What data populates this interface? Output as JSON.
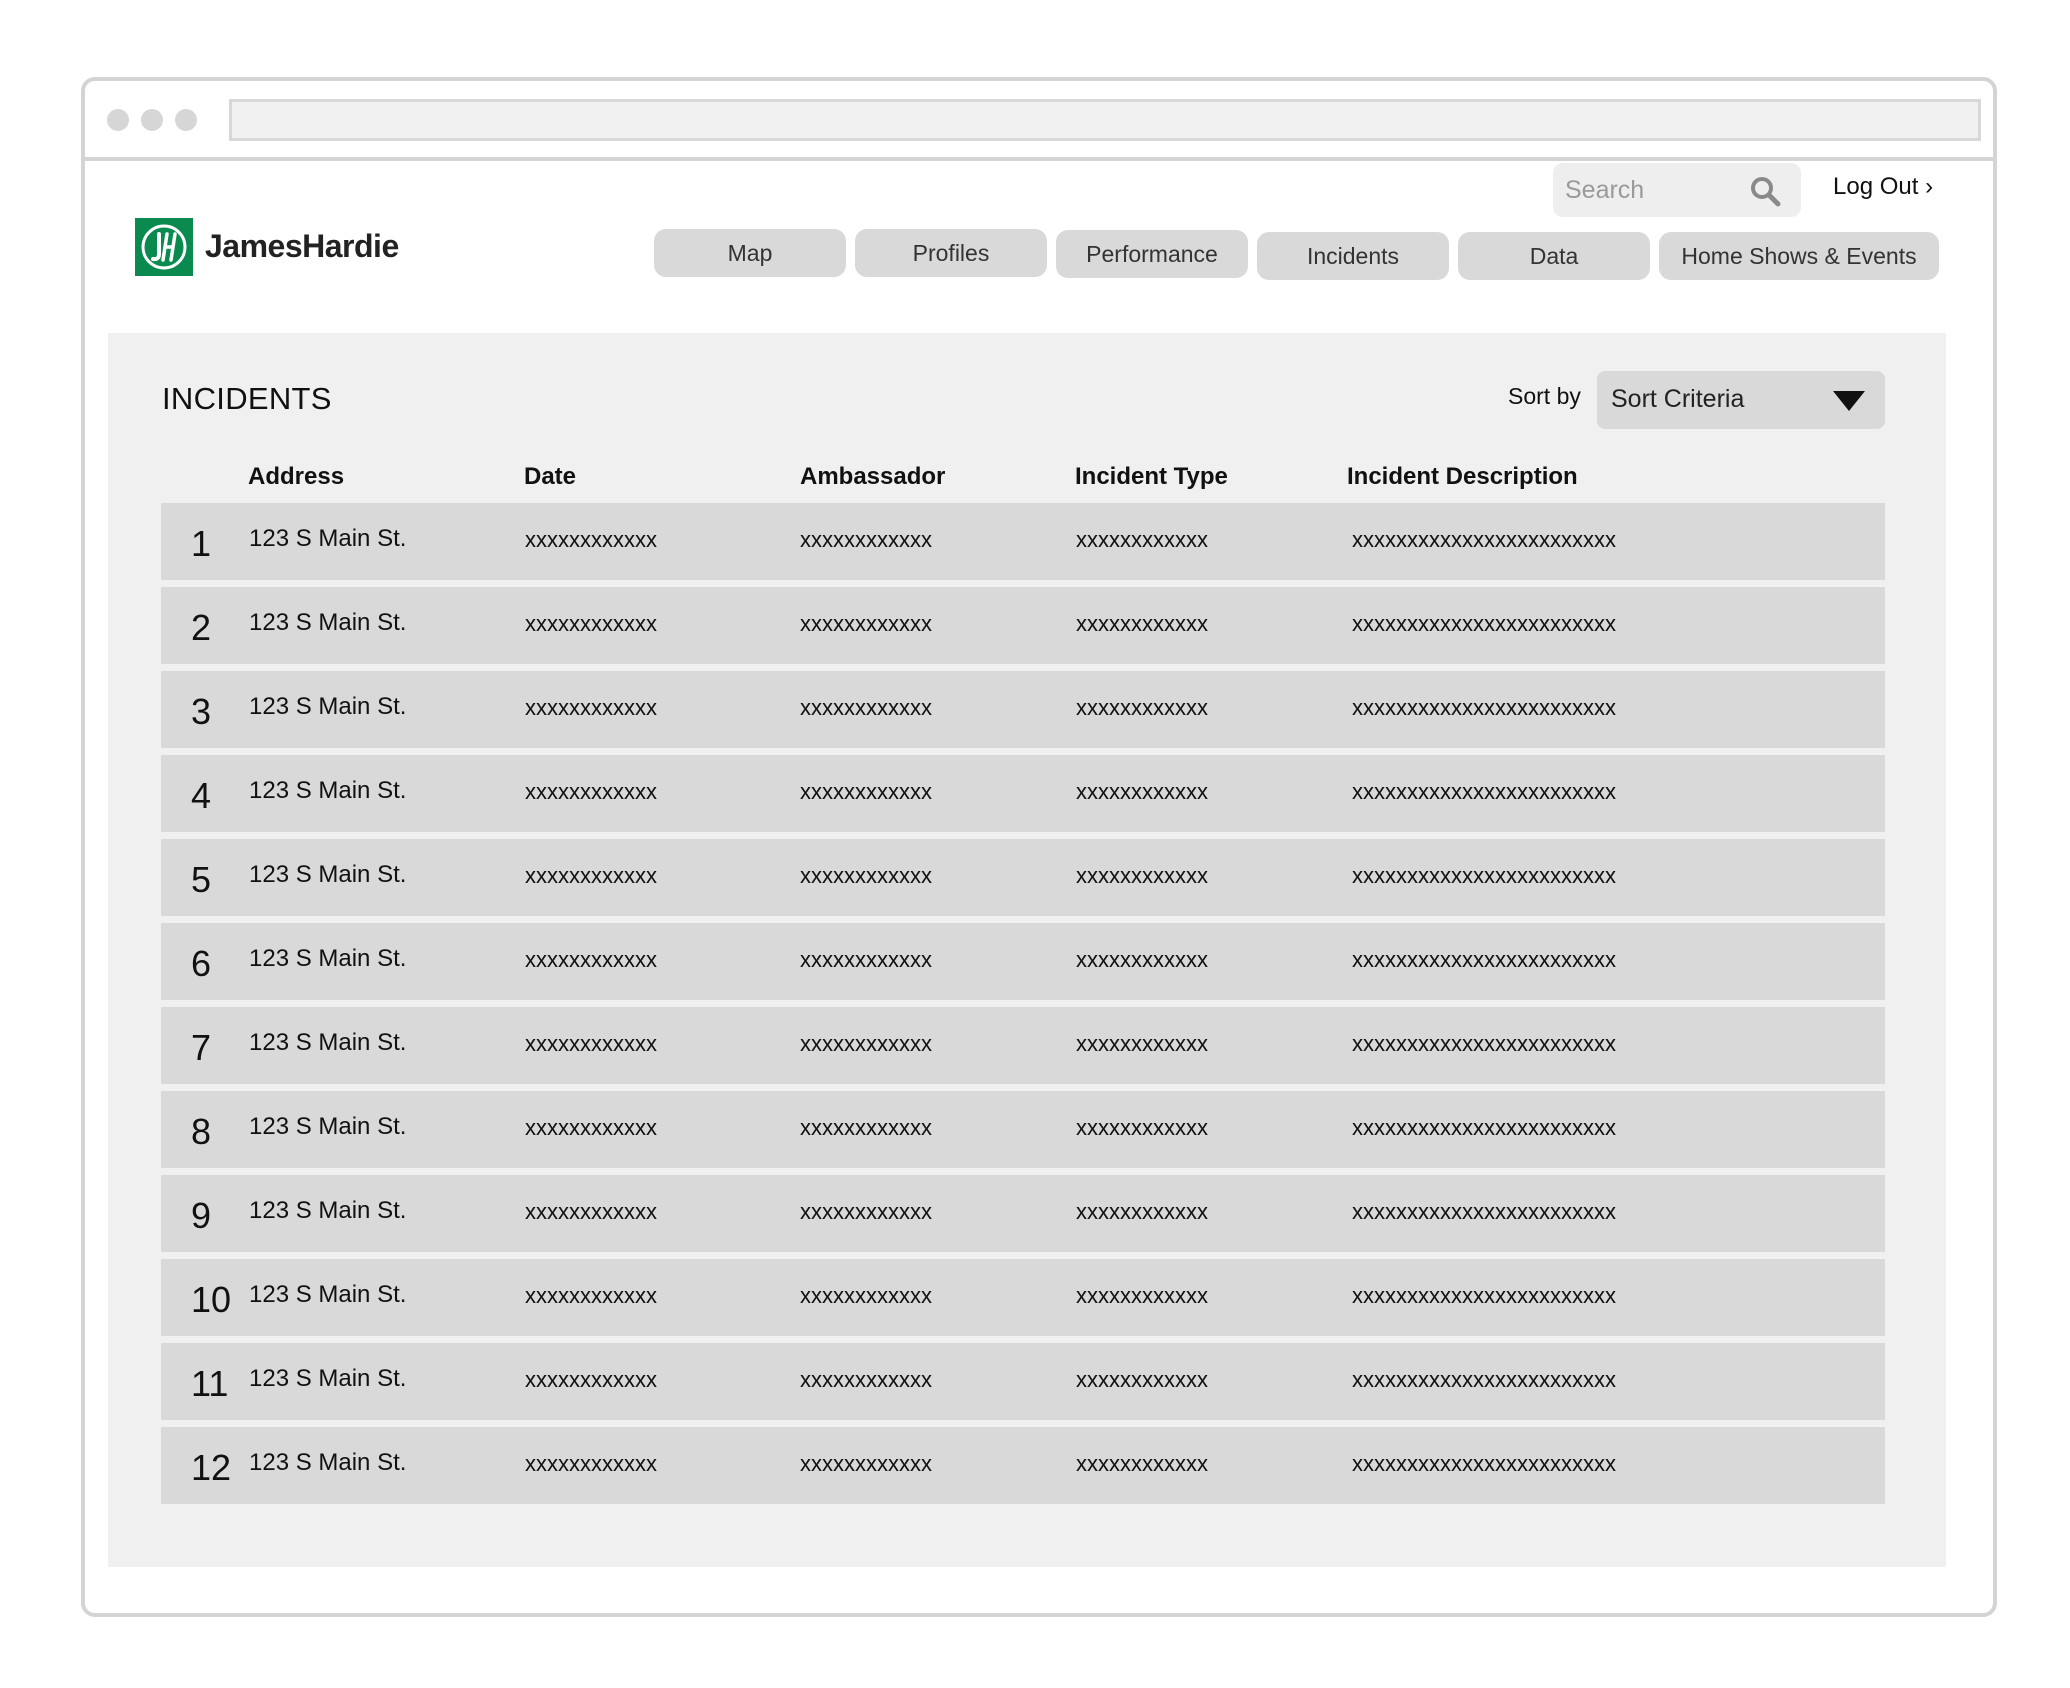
{
  "header": {
    "search_placeholder": "Search",
    "logout_label": "Log Out ›",
    "logo_text": "JamesHardie"
  },
  "nav": [
    {
      "label": "Map"
    },
    {
      "label": "Profiles"
    },
    {
      "label": "Performance"
    },
    {
      "label": "Incidents"
    },
    {
      "label": "Data"
    },
    {
      "label": "Home Shows & Events"
    }
  ],
  "main": {
    "title": "INCIDENTS",
    "sort_label": "Sort by",
    "sort_value": "Sort Criteria",
    "columns": [
      "Address",
      "Date",
      "Ambassador",
      "Incident Type",
      "Incident Description"
    ],
    "rows": [
      {
        "num": "1",
        "address": "123 S Main St.",
        "date": "xxxxxxxxxxxx",
        "ambassador": "xxxxxxxxxxxx",
        "type": "xxxxxxxxxxxx",
        "description": "xxxxxxxxxxxxxxxxxxxxxxxx"
      },
      {
        "num": "2",
        "address": "123 S Main St.",
        "date": "xxxxxxxxxxxx",
        "ambassador": "xxxxxxxxxxxx",
        "type": "xxxxxxxxxxxx",
        "description": "xxxxxxxxxxxxxxxxxxxxxxxx"
      },
      {
        "num": "3",
        "address": "123 S Main St.",
        "date": "xxxxxxxxxxxx",
        "ambassador": "xxxxxxxxxxxx",
        "type": "xxxxxxxxxxxx",
        "description": "xxxxxxxxxxxxxxxxxxxxxxxx"
      },
      {
        "num": "4",
        "address": "123 S Main St.",
        "date": "xxxxxxxxxxxx",
        "ambassador": "xxxxxxxxxxxx",
        "type": "xxxxxxxxxxxx",
        "description": "xxxxxxxxxxxxxxxxxxxxxxxx"
      },
      {
        "num": "5",
        "address": "123 S Main St.",
        "date": "xxxxxxxxxxxx",
        "ambassador": "xxxxxxxxxxxx",
        "type": "xxxxxxxxxxxx",
        "description": "xxxxxxxxxxxxxxxxxxxxxxxx"
      },
      {
        "num": "6",
        "address": "123 S Main St.",
        "date": "xxxxxxxxxxxx",
        "ambassador": "xxxxxxxxxxxx",
        "type": "xxxxxxxxxxxx",
        "description": "xxxxxxxxxxxxxxxxxxxxxxxx"
      },
      {
        "num": "7",
        "address": "123 S Main St.",
        "date": "xxxxxxxxxxxx",
        "ambassador": "xxxxxxxxxxxx",
        "type": "xxxxxxxxxxxx",
        "description": "xxxxxxxxxxxxxxxxxxxxxxxx"
      },
      {
        "num": "8",
        "address": "123 S Main St.",
        "date": "xxxxxxxxxxxx",
        "ambassador": "xxxxxxxxxxxx",
        "type": "xxxxxxxxxxxx",
        "description": "xxxxxxxxxxxxxxxxxxxxxxxx"
      },
      {
        "num": "9",
        "address": "123 S Main St.",
        "date": "xxxxxxxxxxxx",
        "ambassador": "xxxxxxxxxxxx",
        "type": "xxxxxxxxxxxx",
        "description": "xxxxxxxxxxxxxxxxxxxxxxxx"
      },
      {
        "num": "10",
        "address": "123 S Main St.",
        "date": "xxxxxxxxxxxx",
        "ambassador": "xxxxxxxxxxxx",
        "type": "xxxxxxxxxxxx",
        "description": "xxxxxxxxxxxxxxxxxxxxxxxx"
      },
      {
        "num": "11",
        "address": "123 S Main St.",
        "date": "xxxxxxxxxxxx",
        "ambassador": "xxxxxxxxxxxx",
        "type": "xxxxxxxxxxxx",
        "description": "xxxxxxxxxxxxxxxxxxxxxxxx"
      },
      {
        "num": "12",
        "address": "123 S Main St.",
        "date": "xxxxxxxxxxxx",
        "ambassador": "xxxxxxxxxxxx",
        "type": "xxxxxxxxxxxx",
        "description": "xxxxxxxxxxxxxxxxxxxxxxxx"
      }
    ]
  },
  "colors": {
    "brand_green": "#0a8a4f",
    "row_bg": "#d9d9d9",
    "panel_bg": "#f0f0f0"
  },
  "icons": {
    "search": "search-icon",
    "dropdown": "caret-down-icon",
    "logo": "james-hardie-logo-icon"
  }
}
